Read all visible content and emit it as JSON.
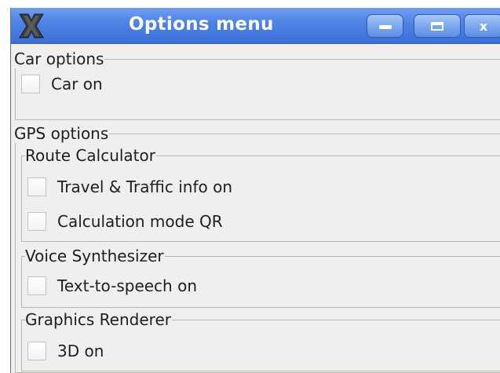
{
  "window": {
    "title": "Options menu",
    "app_icon": "x-window-icon",
    "buttons": {
      "minimize_icon": "minimize-icon",
      "maximize_icon": "maximize-icon",
      "close_glyph": "x"
    },
    "titlebar_color": "#4f84e4"
  },
  "car_options": {
    "label": "Car options",
    "checkboxes": [
      {
        "label": "Car on",
        "checked": false
      }
    ]
  },
  "gps_options": {
    "label": "GPS options",
    "route_calculator": {
      "label": "Route Calculator",
      "checkboxes": [
        {
          "label": "Travel & Traffic info on",
          "checked": false
        },
        {
          "label": "Calculation mode QR",
          "checked": false
        }
      ]
    },
    "voice_synthesizer": {
      "label": "Voice Synthesizer",
      "checkboxes": [
        {
          "label": "Text-to-speech on",
          "checked": false
        }
      ]
    },
    "graphics_renderer": {
      "label": "Graphics Renderer",
      "checkboxes": [
        {
          "label": "3D on",
          "checked": false
        }
      ]
    }
  }
}
